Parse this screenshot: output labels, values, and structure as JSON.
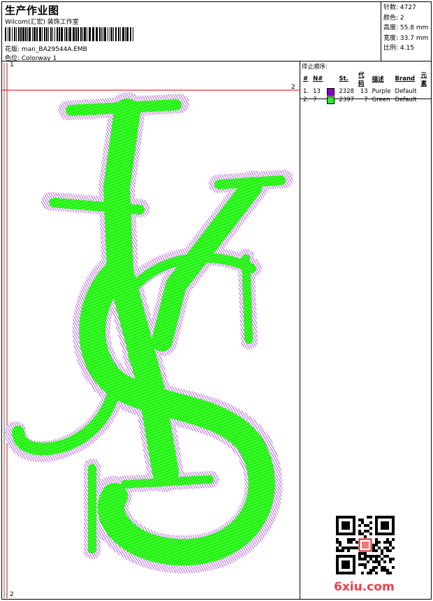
{
  "header": {
    "title": "生产作业图",
    "subtitle": "Wilcom(汇宏) 装饰工作室",
    "design_label": "花版:",
    "design_value": "man_BA29544A.EMB",
    "colorway_label": "色位:",
    "colorway_value": "Colorway 1"
  },
  "stats": [
    {
      "label": "针数:",
      "value": "4727"
    },
    {
      "label": "颜色:",
      "value": "2"
    },
    {
      "label": "高度:",
      "value": "55.8 mm"
    },
    {
      "label": "宽度:",
      "value": "33.7 mm"
    },
    {
      "label": "比例:",
      "value": "4.15"
    }
  ],
  "stop_sequence": {
    "title": "停止顺序:",
    "columns": [
      "#",
      "N#",
      "St.",
      "代码",
      "描述",
      "Brand",
      "元素"
    ],
    "rows": [
      {
        "num": "1.",
        "n": "13",
        "color": "#8a00c8",
        "st": "2328",
        "code": "13",
        "desc": "Purple",
        "brand": "Default"
      },
      {
        "num": "2.",
        "n": "7",
        "color": "#22ee22",
        "st": "2397",
        "code": "7",
        "desc": "Green",
        "brand": "Default"
      }
    ]
  },
  "ruler": {
    "top_left": "1",
    "top_right": "2",
    "bottom_left": "2"
  },
  "colors": {
    "purple": "#8a00c8",
    "green": "#33ff22",
    "guide_red": "#e00000"
  },
  "watermark": "6xiu.com",
  "icons": [
    "qr-code-icon",
    "seal-stamp-icon"
  ]
}
